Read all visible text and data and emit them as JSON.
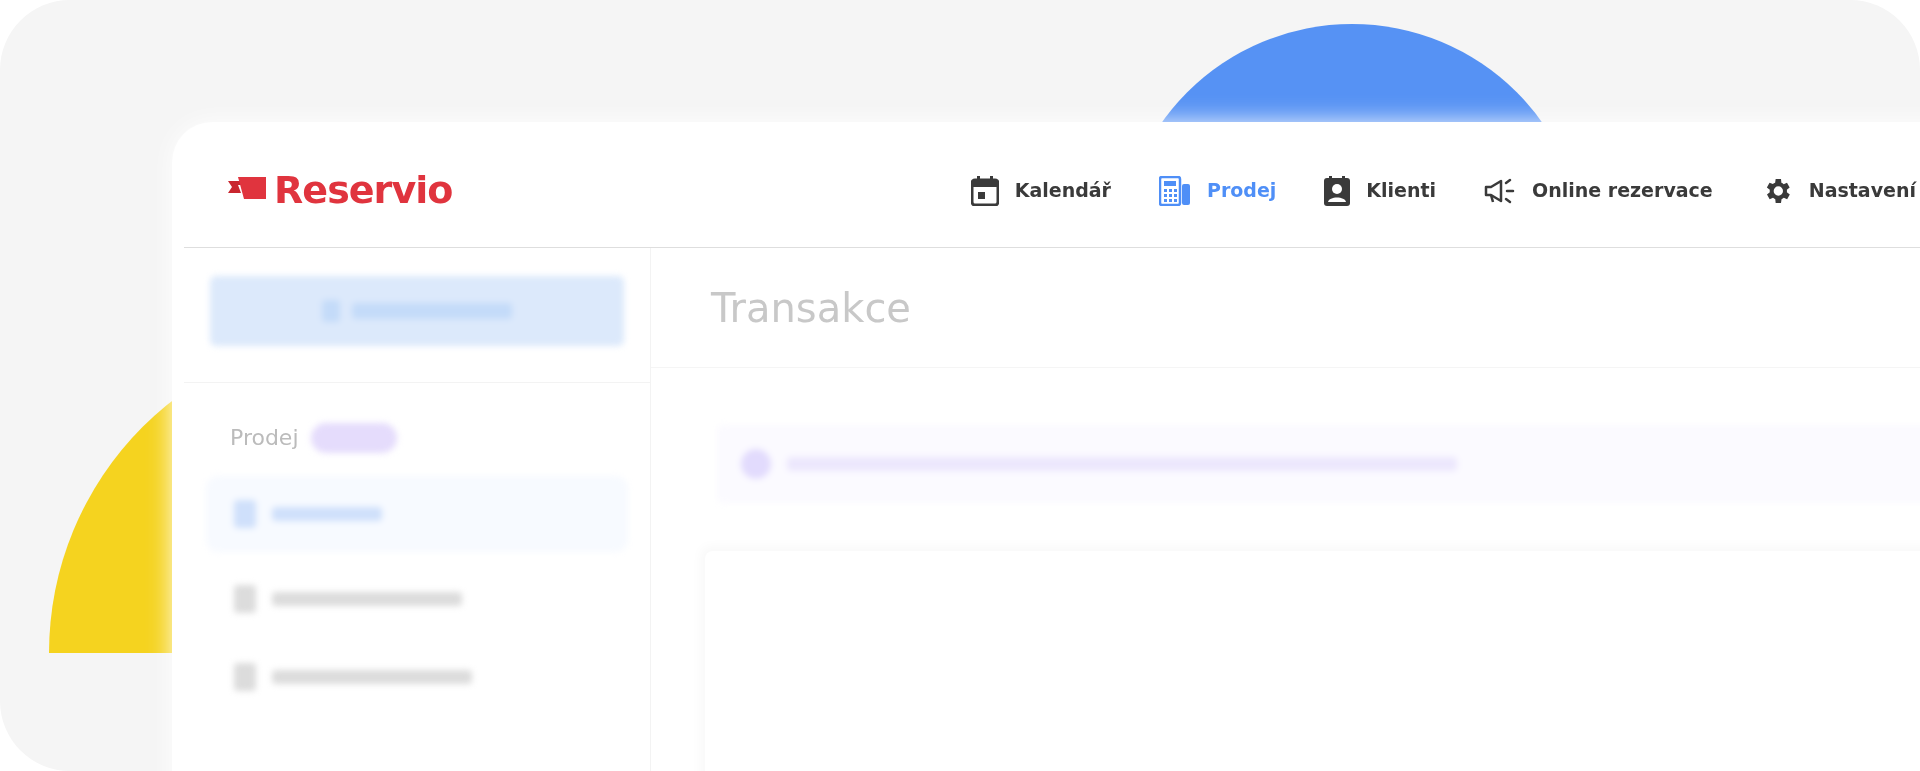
{
  "logo": {
    "text": "Reservio"
  },
  "nav": [
    {
      "label": "Kalendář",
      "kind": "calendar",
      "selected": false
    },
    {
      "label": "Prodej",
      "kind": "register",
      "selected": true
    },
    {
      "label": "Klienti",
      "kind": "contact",
      "selected": false
    },
    {
      "label": "Online rezervace",
      "kind": "megaphone",
      "selected": false
    },
    {
      "label": "Nastavení",
      "kind": "gear",
      "selected": false
    }
  ],
  "sidebar": {
    "heading": "Prodej",
    "items": [
      {
        "selected": true
      },
      {
        "selected": false
      },
      {
        "selected": false
      }
    ]
  },
  "page": {
    "title": "Transakce"
  }
}
